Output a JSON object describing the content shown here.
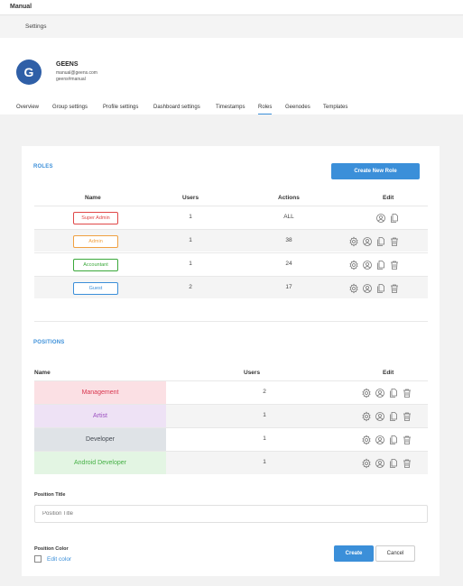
{
  "app": {
    "title": "Manual",
    "section": "Settings"
  },
  "org": {
    "avatar_letter": "G",
    "name": "GEENS",
    "email": "manual@geens.com",
    "handle": "geens#manual"
  },
  "tabs": [
    {
      "label": "Overview"
    },
    {
      "label": "Group settings"
    },
    {
      "label": "Profile settings"
    },
    {
      "label": "Dashboard settings"
    },
    {
      "label": "Timestamps"
    },
    {
      "label": "Roles"
    },
    {
      "label": "Geenodes"
    },
    {
      "label": "Templates"
    }
  ],
  "active_tab": "Roles",
  "roles": {
    "title": "ROLES",
    "create_button": "Create New Role",
    "headers": {
      "name": "Name",
      "users": "Users",
      "actions": "Actions",
      "edit": "Edit"
    },
    "rows": [
      {
        "name": "Super Admin",
        "users": "1",
        "actions": "ALL",
        "color": "#e04848"
      },
      {
        "name": "Admin",
        "users": "1",
        "actions": "38",
        "color": "#f0a040"
      },
      {
        "name": "Accountant",
        "users": "1",
        "actions": "24",
        "color": "#3aa83a"
      },
      {
        "name": "Guest",
        "users": "2",
        "actions": "17",
        "color": "#3b8fd9"
      }
    ]
  },
  "positions": {
    "title": "POSITIONS",
    "headers": {
      "name": "Name",
      "users": "Users",
      "edit": "Edit"
    },
    "rows": [
      {
        "name": "Management",
        "users": "2",
        "color": "#d9364f",
        "bg": "#fbe0e4"
      },
      {
        "name": "Artist",
        "users": "1",
        "color": "#9b4fc0",
        "bg": "#eee2f5"
      },
      {
        "name": "Developer",
        "users": "1",
        "color": "#444a52",
        "bg": "#dfe3e7"
      },
      {
        "name": "Android Developer",
        "users": "1",
        "color": "#44b044",
        "bg": "#e3f5e3"
      }
    ]
  },
  "form": {
    "position_title_label": "Position Title",
    "position_title_placeholder": "Position Title",
    "position_color_label": "Position Color",
    "edit_color_link": "Edit color",
    "create_button": "Create",
    "cancel_button": "Cancel"
  },
  "colors": {
    "accent": "#3b8fd9",
    "avatar": "#2f5fa7"
  }
}
